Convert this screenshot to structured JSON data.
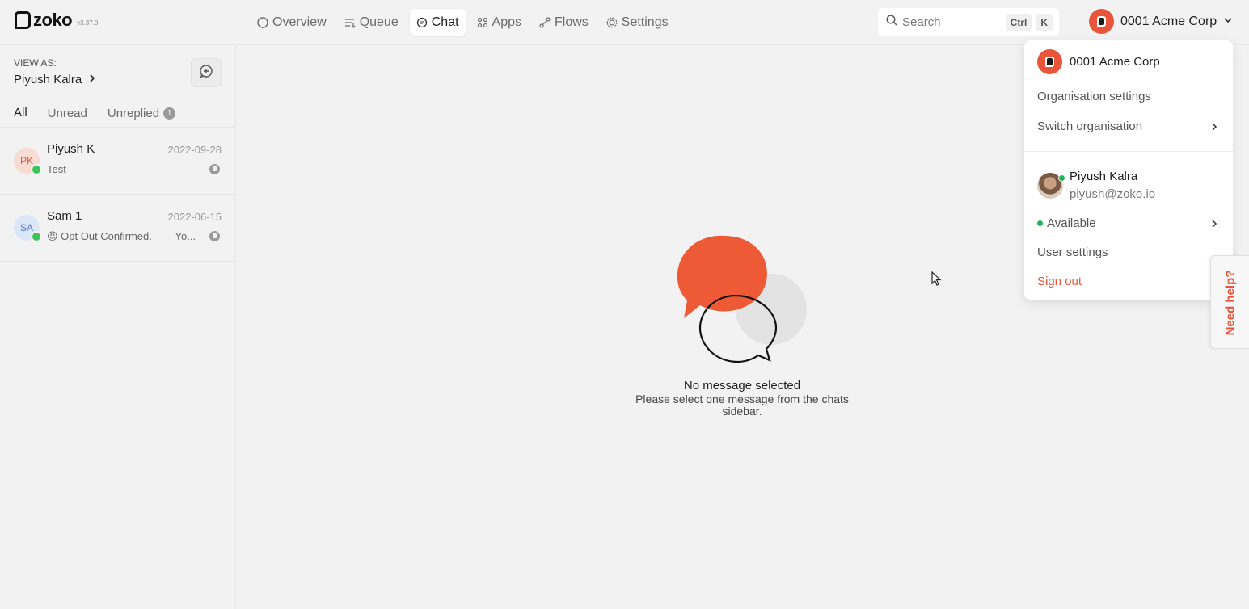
{
  "app": {
    "logo_text": "zoko",
    "version": "v3.37.0"
  },
  "nav": {
    "items": [
      {
        "label": "Overview",
        "icon": "circle-icon"
      },
      {
        "label": "Queue",
        "icon": "queue-icon"
      },
      {
        "label": "Chat",
        "icon": "chat-icon",
        "active": true
      },
      {
        "label": "Apps",
        "icon": "apps-grid-icon"
      },
      {
        "label": "Flows",
        "icon": "flows-icon"
      },
      {
        "label": "Settings",
        "icon": "gear-icon"
      }
    ]
  },
  "search": {
    "placeholder": "Search",
    "shortcut_key1": "Ctrl",
    "shortcut_key2": "K"
  },
  "org_button": {
    "name": "0001 Acme Corp"
  },
  "sidebar": {
    "view_as_label": "VIEW AS:",
    "view_as_user": "Piyush Kalra",
    "tabs": [
      {
        "label": "All",
        "active": true
      },
      {
        "label": "Unread"
      },
      {
        "label": "Unreplied",
        "count": "1"
      }
    ],
    "chats": [
      {
        "initials": "PK",
        "name": "Piyush K",
        "date": "2022-09-28",
        "preview": "Test",
        "avatar_bg": "#f8dcd4",
        "avatar_fg": "#e8553a"
      },
      {
        "initials": "SA",
        "name": "Sam 1",
        "date": "2022-06-15",
        "preview": "😡 Opt Out Confirmed. ----- Yo...",
        "avatar_bg": "#dbe6f6",
        "avatar_fg": "#4a78c8"
      }
    ]
  },
  "empty_state": {
    "title": "No message selected",
    "subtitle": "Please select one message from the chats sidebar."
  },
  "dropdown": {
    "org_name": "0001 Acme Corp",
    "organisation_settings": "Organisation settings",
    "switch_organisation": "Switch organisation",
    "user_name": "Piyush Kalra",
    "user_email": "piyush@zoko.io",
    "status": "Available",
    "user_settings": "User settings",
    "sign_out": "Sign out"
  },
  "help": {
    "label": "Need help?"
  },
  "colors": {
    "brand": "#e8553a",
    "online": "#22b35d",
    "whatsapp": "#3ec45a"
  }
}
